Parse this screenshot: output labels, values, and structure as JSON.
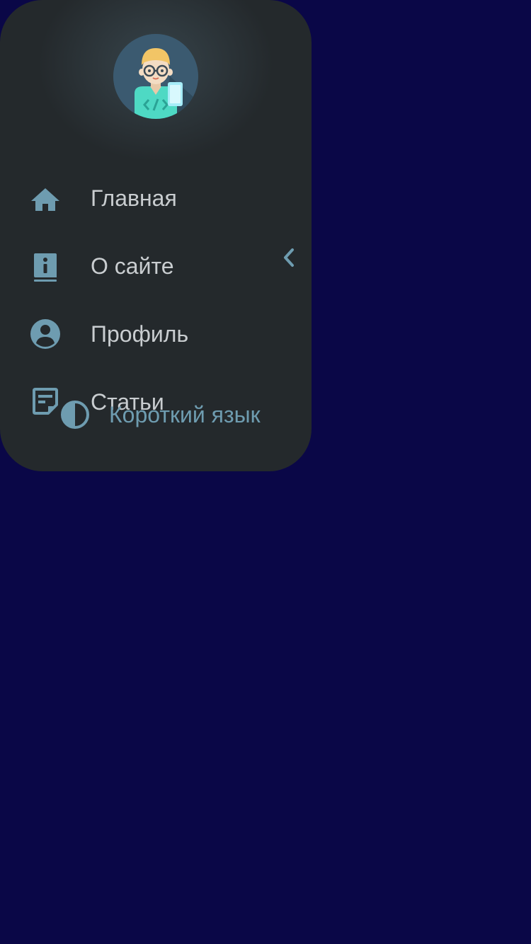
{
  "colors": {
    "page_background": "#0a0747",
    "drawer_background": "#24292c",
    "icon": "#6e9cb0",
    "label": "#c9cdd0",
    "accent_label": "#6e9cb0"
  },
  "header": {
    "avatar_icon": "developer-avatar-icon"
  },
  "drawer": {
    "collapse_icon": "chevron-left-icon"
  },
  "nav": {
    "items": [
      {
        "label": "Главная",
        "icon": "home-icon"
      },
      {
        "label": "О сайте",
        "icon": "info-book-icon"
      },
      {
        "label": "Профиль",
        "icon": "account-circle-icon"
      },
      {
        "label": "Статьи",
        "icon": "article-icon"
      }
    ]
  },
  "language_toggle": {
    "label": "Короткий язык",
    "icon": "contrast-icon"
  }
}
